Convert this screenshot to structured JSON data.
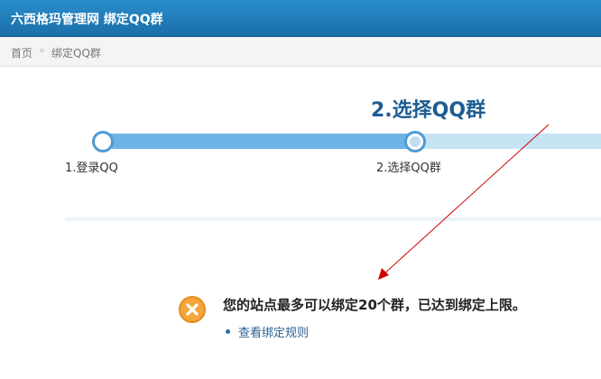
{
  "header": {
    "title": "六西格玛管理网 绑定QQ群"
  },
  "breadcrumb": {
    "home": "首页",
    "separator": "»",
    "current": "绑定QQ群"
  },
  "wizard": {
    "current_step_heading": "2.选择QQ群",
    "steps": [
      {
        "label": "1.登录QQ",
        "state": "done"
      },
      {
        "label": "2.选择QQ群",
        "state": "current"
      }
    ]
  },
  "notice": {
    "icon": "error-x-icon",
    "message": "您的站点最多可以绑定20个群，已达到绑定上限。",
    "rule_link": "查看绑定规则"
  },
  "colors": {
    "header": "#1a6fa8",
    "progress_done": "#6cb4e6",
    "progress_rest": "#c6e4f4",
    "heading": "#1d5d93",
    "annotation_arrow": "#cc0000",
    "error_icon": "#f6a53a"
  }
}
